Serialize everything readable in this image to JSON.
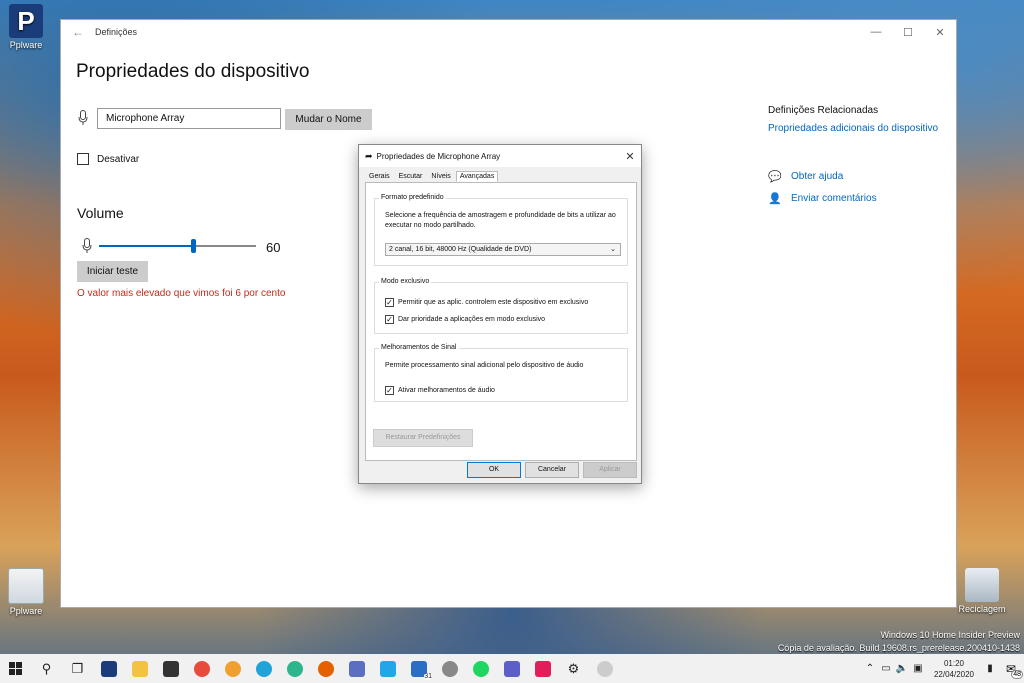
{
  "desktop": {
    "top_icon_label": "Pplware",
    "top_icon_glyph": "P",
    "bottom_left_label": "Pplware",
    "recycle_label": "Reciclagem"
  },
  "settings": {
    "window_title": "Definições",
    "page_title": "Propriedades do dispositivo",
    "device_name_value": "Microphone Array",
    "rename_label": "Mudar o Nome",
    "disable_label": "Desativar",
    "volume_title": "Volume",
    "volume_value": 60,
    "volume_value_text": "60",
    "start_test_label": "Iniciar teste",
    "warning_text": "O valor mais elevado que vimos foi 6 por cento",
    "related_title": "Definições Relacionadas",
    "related_link": "Propriedades adicionais do dispositivo",
    "help_label": "Obter ajuda",
    "feedback_label": "Enviar comentários"
  },
  "dialog": {
    "title": "Propriedades de Microphone Array",
    "tabs": [
      "Gerais",
      "Escutar",
      "Níveis",
      "Avançadas"
    ],
    "active_tab": "Avançadas",
    "default_format": {
      "title": "Formato predefinido",
      "desc": "Selecione a frequência de amostragem e profundidade de bits a utilizar ao executar no modo partilhado.",
      "selected": "2 canal, 16 bit, 48000 Hz (Qualidade de DVD)"
    },
    "exclusive": {
      "title": "Modo exclusivo",
      "option1": "Permitir que as aplic. controlem este dispositivo em exclusivo",
      "option1_checked": true,
      "option2": "Dar prioridade a aplicações em modo exclusivo",
      "option2_checked": true
    },
    "signal": {
      "title": "Melhoramentos de Sinal",
      "desc": "Permite processamento sinal adicional pelo dispositivo de áudio",
      "option": "Ativar melhoramentos de áudio",
      "option_checked": true
    },
    "restore_label": "Restaurar Predefinições",
    "ok_label": "OK",
    "cancel_label": "Cancelar",
    "apply_label": "Aplicar"
  },
  "watermark": {
    "line1": "Windows 10 Home Insider Preview",
    "line2": "Cópia de avaliação. Build 19608.rs_prerelease.200410-1438"
  },
  "taskbar": {
    "time": "01:20",
    "date": "22/04/2020",
    "notification_count": "48",
    "calendar_badge": "31"
  },
  "colors": {
    "accent": "#0067c0",
    "warning": "#c42b1c"
  }
}
